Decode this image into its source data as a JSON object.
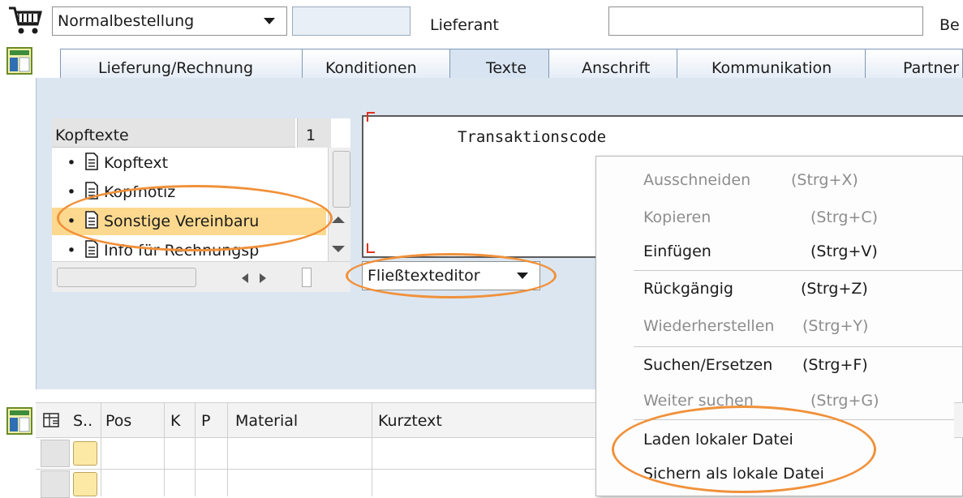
{
  "header": {
    "order_type": "Normalbestellung",
    "supplier_label": "Lieferant",
    "be_label": "Be"
  },
  "tabs": [
    "Lieferung/Rechnung",
    "Konditionen",
    "Texte",
    "Anschrift",
    "Kommunikation",
    "Partner"
  ],
  "texts_panel": {
    "header": "Kopftexte",
    "col_header": "1",
    "items": [
      "Kopftext",
      "Kopfnotiz",
      "Sonstige Vereinbaru",
      "Info für Rechnungsp"
    ],
    "selected_index": 2
  },
  "editor": {
    "first_line": "Transaktionscode",
    "mode_label": "Fließtexteditor"
  },
  "context_menu": {
    "items": [
      {
        "label": "Ausschneiden",
        "shortcut": "(Strg+X)",
        "enabled": false
      },
      {
        "label": "Kopieren",
        "shortcut": "(Strg+C)",
        "enabled": false
      },
      {
        "label": "Einfügen",
        "shortcut": "(Strg+V)",
        "enabled": true
      },
      {
        "label": "Rückgängig",
        "shortcut": "(Strg+Z)",
        "enabled": true
      },
      {
        "label": "Wiederherstellen",
        "shortcut": "(Strg+Y)",
        "enabled": false
      },
      {
        "label": "Suchen/Ersetzen",
        "shortcut": "(Strg+F)",
        "enabled": true
      },
      {
        "label": "Weiter suchen",
        "shortcut": "(Strg+G)",
        "enabled": false
      },
      {
        "label": "Laden lokaler Datei",
        "shortcut": "",
        "enabled": true
      },
      {
        "label": "Sichern als lokale Datei",
        "shortcut": "",
        "enabled": true
      }
    ]
  },
  "item_table": {
    "columns": [
      "S..",
      "Pos",
      "K",
      "P",
      "Material",
      "Kurztext"
    ]
  },
  "colors": {
    "accent_orange": "#f0913a",
    "selection_yellow": "#fcd98e",
    "panel_blue": "#dce6f1"
  }
}
